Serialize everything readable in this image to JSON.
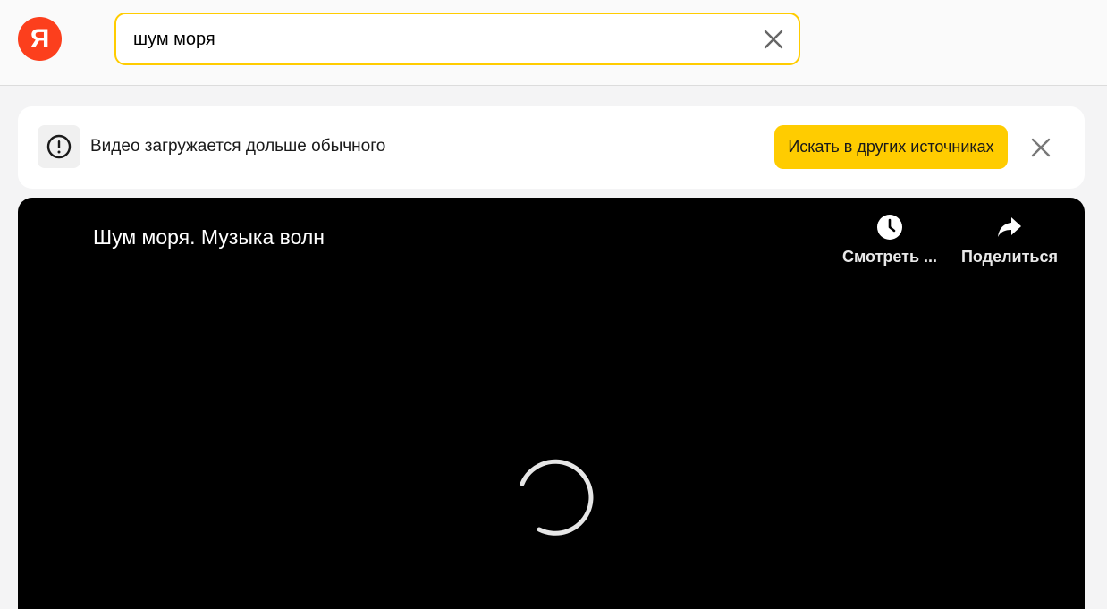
{
  "header": {
    "logo_text": "Я",
    "search": {
      "value": "шум моря",
      "placeholder": ""
    }
  },
  "banner": {
    "message": "Видео загружается дольше обычного",
    "button_label": "Искать в других источниках"
  },
  "player": {
    "title": "Шум моря. Музыка волн",
    "actions": [
      {
        "label": "Смотреть ...",
        "icon": "clock-icon"
      },
      {
        "label": "Поделиться",
        "icon": "share-icon"
      }
    ],
    "state": "loading"
  },
  "colors": {
    "accent": "#ffcc00",
    "logo": "#fc3f1d",
    "player_bg": "#000000"
  }
}
